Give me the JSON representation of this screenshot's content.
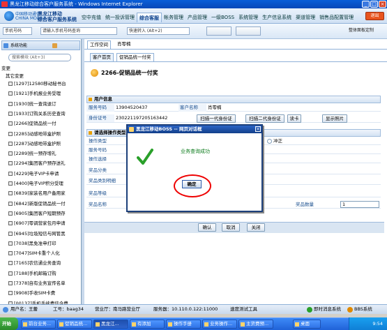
{
  "window": {
    "title": "黑龙江移动综合客户服务系统 - Windows Internet Explorer",
    "btn_min": "_",
    "btn_max": "□",
    "btn_close": "×"
  },
  "logo": {
    "line1": "中国移动通信",
    "line2": "CHINA MOBILE",
    "brand1": "黑龙江移动",
    "brand2": "综合客户服务系统"
  },
  "mainnav": [
    "空中充值",
    "统一投诉管理",
    "综合客服",
    "帐务管理",
    "产品管理",
    "一级BOSS",
    "系统管理",
    "生产信息系统",
    "渠道管理",
    "销售品配置管理"
  ],
  "mainnav_active": 2,
  "exit_label": "退出",
  "toolbar": {
    "num_type": "手机号码",
    "num_placeholder": "请输入手机号码查询",
    "quick_placeholder": "快速转入 (Alt+2)",
    "btn_a": "",
    "btn_b": "",
    "customize": "整体面板定制"
  },
  "sidebar": {
    "head_sys": "系统功能",
    "search_placeholder": "搜索模块 (Alt+3)",
    "root": "变更",
    "group": "其它变更",
    "items": [
      "[1297]12580移动秘书台",
      "[1921]手机报业务受理",
      "[1930]统一查询退订",
      "[1933]订购关系历史查询",
      "[2266]促销品统一付",
      "[2285]动感地带盒护照",
      "[2287]动感地带盒护照",
      "[2289]统一预存增礼",
      "[2294]集团客户预存送礼",
      "[4229]电子VIP卡申请",
      "[4400]电子VIP积分受理",
      "[6839]家装名用户备用家",
      "[6842]新版促销品统一付",
      "[6905]集团客户短期预存",
      "[6907]零调营家包月申请",
      "[6945]垃圾短信与网管黑",
      "[7038]黑免准申打印",
      "[7047]SIM卡重个人化",
      "[7165]农信通业务查询",
      "[7188]手机邮箱订购",
      "[7378]自有业务宣传名单",
      "[9908]手收SIM卡费",
      "[00137]手机手续费信令费"
    ]
  },
  "tabs": {
    "workspace": "工作空间",
    "user": "肖零楠",
    "home": "客户首页",
    "current": "促销品统一付奖"
  },
  "page": {
    "title": "2266-促销品统一付奖"
  },
  "userinfo": {
    "section": "用户信息",
    "service_label": "服务号码",
    "service_value": "13904520437",
    "customer_label": "客户名称",
    "customer_value": "肖零楠",
    "id_label": "身份证号",
    "id_value": "230221197205163442",
    "btn_scan1": "扫描一代身份证",
    "btn_scan2": "扫描二代身份证",
    "btn_read": "读卡",
    "btn_photo": "显示照片"
  },
  "promo": {
    "section": "请选择操作类型",
    "op_type": "操作类型",
    "service_no": "服务号码",
    "op_choice": "操作选择",
    "prize_class": "奖品分类",
    "prize_detail": "奖品类别明细",
    "prize_level": "奖品等级",
    "prize_name": "奖品名称",
    "prize_qty": "奖品数量",
    "qty_value": "1",
    "radio_reversal": "冲正"
  },
  "actions": {
    "confirm": "确认",
    "cancel": "取消",
    "close": "关闭"
  },
  "dialog": {
    "title": "黑龙江移动BOSS -- 网页对话框",
    "message": "业务查询成功",
    "ok": "确定",
    "close": "×"
  },
  "status": {
    "user": "用户名：王蕾",
    "job": "工号：baag34",
    "hall": "营业厅：南马路营业厅",
    "server": "服务器：10.110.0.122:11000",
    "speed": "速度测试工具",
    "im": "即时消息系统",
    "bbs": "BBS系统"
  },
  "taskbar": {
    "start": "开始",
    "items": [
      "前台业务...",
      "促销品统...",
      "黑龙江...",
      "有添加",
      "操作手册",
      "业务操作...",
      "主货费预...",
      "桌面"
    ],
    "active": 2,
    "time": "9:54"
  }
}
